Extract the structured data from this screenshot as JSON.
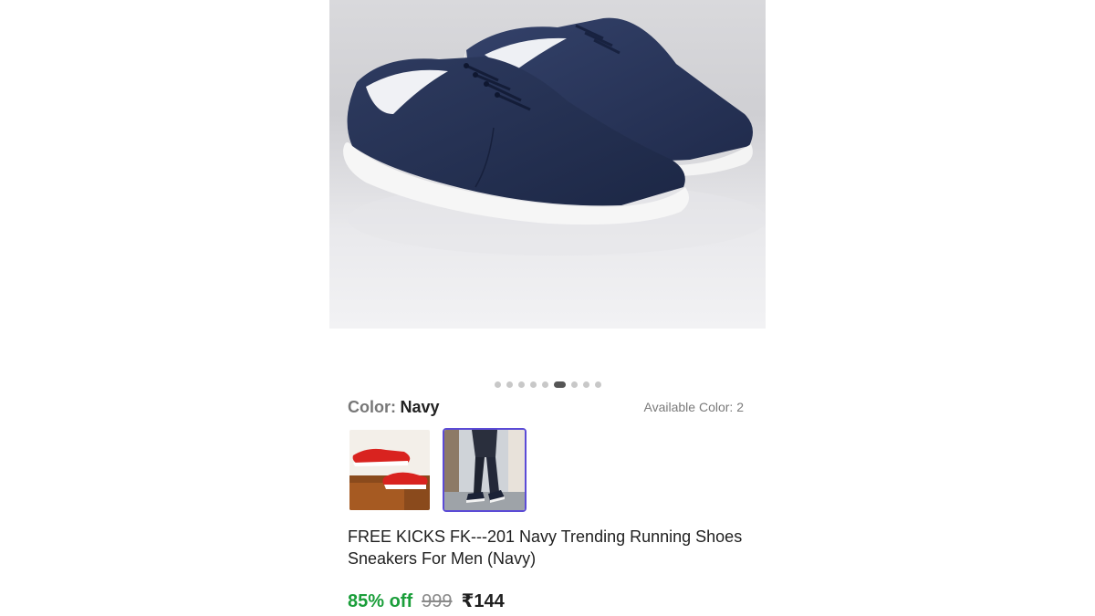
{
  "product": {
    "image_alt": "Navy canvas sneakers",
    "carousel": {
      "count": 9,
      "active_index": 5
    },
    "color": {
      "label": "Color:",
      "value": "Navy"
    },
    "available_colors": "Available Color: 2",
    "swatches": [
      {
        "name": "Red",
        "selected": false
      },
      {
        "name": "Navy",
        "selected": true
      }
    ],
    "title": "FREE KICKS FK---201 Navy Trending Running Shoes Sneakers For Men (Navy)",
    "discount": "85% off",
    "mrp": "999",
    "price": "₹144"
  },
  "colors": {
    "accent": "#5b4bd6",
    "discount_green": "#1a9e3a",
    "shoe_navy": "#263354"
  }
}
